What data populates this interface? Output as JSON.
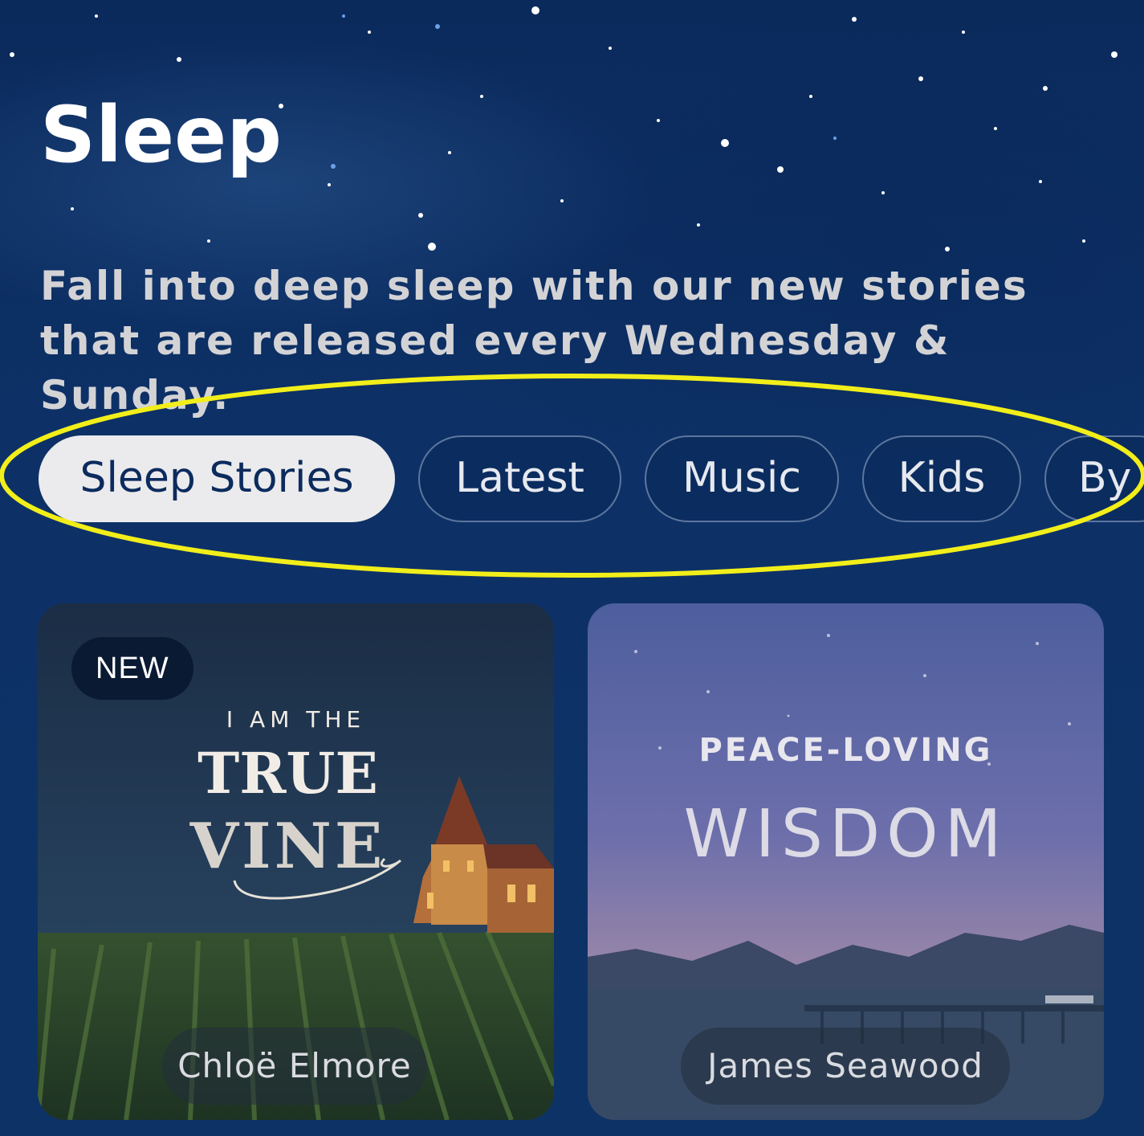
{
  "header": {
    "title": "Sleep",
    "subtitle": "Fall into deep sleep with our new stories that are released every Wednesday & Sunday."
  },
  "filters": {
    "chips": [
      {
        "label": "Sleep Stories",
        "active": true
      },
      {
        "label": "Latest",
        "active": false
      },
      {
        "label": "Music",
        "active": false
      },
      {
        "label": "Kids",
        "active": false
      },
      {
        "label": "By",
        "active": false
      }
    ],
    "highlight_color": "#f2ee1a"
  },
  "cards": [
    {
      "badge": "NEW",
      "cover_line1": "I AM THE",
      "cover_line2": "TRUE",
      "cover_line3": "VINE",
      "narrator": "Chloë Elmore"
    },
    {
      "cover_line1": "PEACE-LOVING",
      "cover_line2": "WISDOM",
      "narrator": "James Seawood"
    }
  ],
  "colors": {
    "background": "#0c2f66",
    "chip_active_bg": "#ebebed",
    "chip_active_text": "#0c2b5e",
    "text_light": "#d3d3d6"
  }
}
